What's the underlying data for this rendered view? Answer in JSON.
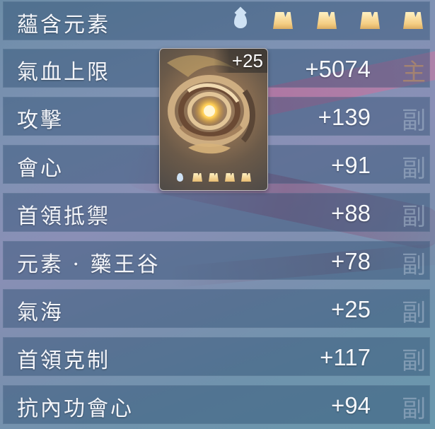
{
  "header": {
    "label": "蘊含元素",
    "icons": [
      "water-drop-icon",
      "slot-icon",
      "slot-icon",
      "slot-icon",
      "slot-icon"
    ]
  },
  "item": {
    "enhance_level": "+25",
    "icon": "swirl-orb-icon"
  },
  "stats": [
    {
      "label": "氣血上限",
      "value": "+5074",
      "tag": "主"
    },
    {
      "label": "攻擊",
      "value": "+139",
      "tag": "副"
    },
    {
      "label": "會心",
      "value": "+91",
      "tag": "副"
    },
    {
      "label": "首領抵禦",
      "value": "+88",
      "tag": "副"
    },
    {
      "label": "元素 · 藥王谷",
      "value": "+78",
      "tag": "副"
    },
    {
      "label": "氣海",
      "value": "+25",
      "tag": "副"
    },
    {
      "label": "首領克制",
      "value": "+117",
      "tag": "副"
    },
    {
      "label": "抗內功會心",
      "value": "+94",
      "tag": "副"
    }
  ],
  "colors": {
    "row_bg": "#284b6e",
    "text": "#f4f6fb",
    "slot_gold": "#f4cd83",
    "drop_blue": "#cfe2f4"
  }
}
